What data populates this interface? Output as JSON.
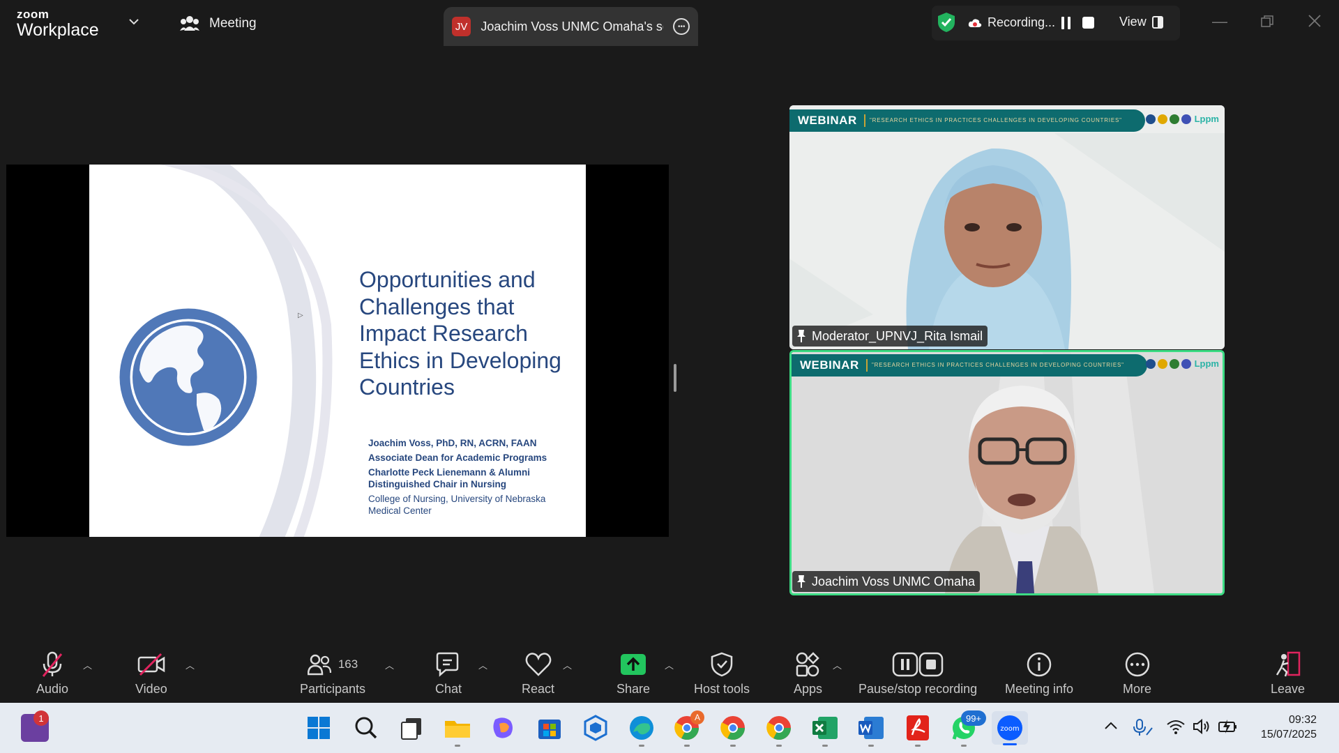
{
  "app": {
    "brand_small": "zoom",
    "brand_large": "Workplace",
    "meeting_label": "Meeting",
    "share_tab_initials": "JV",
    "share_tab_label": "Joachim Voss UNMC Omaha's scr",
    "recording_label": "Recording...",
    "view_label": "View"
  },
  "slide": {
    "title": "Opportunities and Challenges that Impact Research Ethics in Developing Countries",
    "author_line1": "Joachim Voss, PhD, RN, ACRN, FAAN",
    "author_line2": "Associate Dean for Academic Programs",
    "author_line3": "Charlotte Peck Lienemann & Alumni Distinguished Chair in Nursing",
    "affiliation": "College of Nursing, University of Nebraska Medical Center"
  },
  "tiles": [
    {
      "banner_title": "WEBINAR",
      "banner_subtitle": "\"RESEARCH ETHICS IN PRACTICES CHALLENGES IN DEVELOPING COUNTRIES\"",
      "logo_text": "Lppm",
      "name": "Moderator_UPNVJ_Rita Ismail"
    },
    {
      "banner_title": "WEBINAR",
      "banner_subtitle": "\"RESEARCH ETHICS IN PRACTICES CHALLENGES IN DEVELOPING COUNTRIES\"",
      "logo_text": "Lppm",
      "name": "Joachim Voss UNMC Omaha"
    }
  ],
  "toolbar": {
    "audio": "Audio",
    "video": "Video",
    "participants": "Participants",
    "participants_count": "163",
    "chat": "Chat",
    "react": "React",
    "share": "Share",
    "host_tools": "Host tools",
    "apps": "Apps",
    "recording": "Pause/stop recording",
    "meeting_info": "Meeting info",
    "more": "More",
    "leave": "Leave"
  },
  "taskbar": {
    "notification_badge": "1",
    "whatsapp_badge": "99+",
    "chrome_badge": "A",
    "time": "09:32",
    "date": "15/07/2025"
  },
  "colors": {
    "accent_green": "#3ddc84",
    "slide_blue": "#27477e",
    "globe_blue": "#5078b8",
    "banner_teal": "#0d6b6e",
    "leave_red": "#e0245e"
  }
}
